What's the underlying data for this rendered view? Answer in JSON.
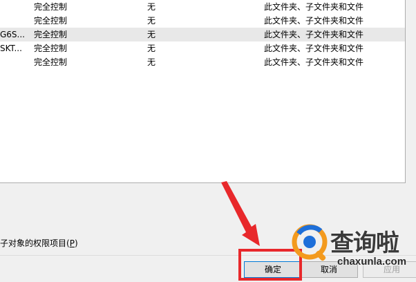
{
  "permissions": {
    "rows": [
      {
        "principal": "",
        "access": "完全控制",
        "inherited_from": "无",
        "applies_to": "此文件夹、子文件夹和文件",
        "selected": false
      },
      {
        "principal": "",
        "access": "完全控制",
        "inherited_from": "无",
        "applies_to": "此文件夹、子文件夹和文件",
        "selected": false
      },
      {
        "principal": "G6S...",
        "access": "完全控制",
        "inherited_from": "无",
        "applies_to": "此文件夹、子文件夹和文件",
        "selected": true
      },
      {
        "principal": "SKT...",
        "access": "完全控制",
        "inherited_from": "无",
        "applies_to": "此文件夹、子文件夹和文件",
        "selected": false
      },
      {
        "principal": "",
        "access": "完全控制",
        "inherited_from": "无",
        "applies_to": "此文件夹、子文件夹和文件",
        "selected": false
      }
    ]
  },
  "replace_child": {
    "label": "子对象的权限项目(",
    "hotkey": "P",
    "suffix": ")"
  },
  "buttons": {
    "ok": "确定",
    "cancel": "取消",
    "apply": "应用"
  },
  "watermark": {
    "title": "查询啦",
    "url": "chaxunla.com"
  },
  "colors": {
    "highlight": "#e8282b",
    "selected_row": "#e8e8e8",
    "logo_orange": "#f39a1e",
    "logo_blue": "#1e6fd9"
  }
}
